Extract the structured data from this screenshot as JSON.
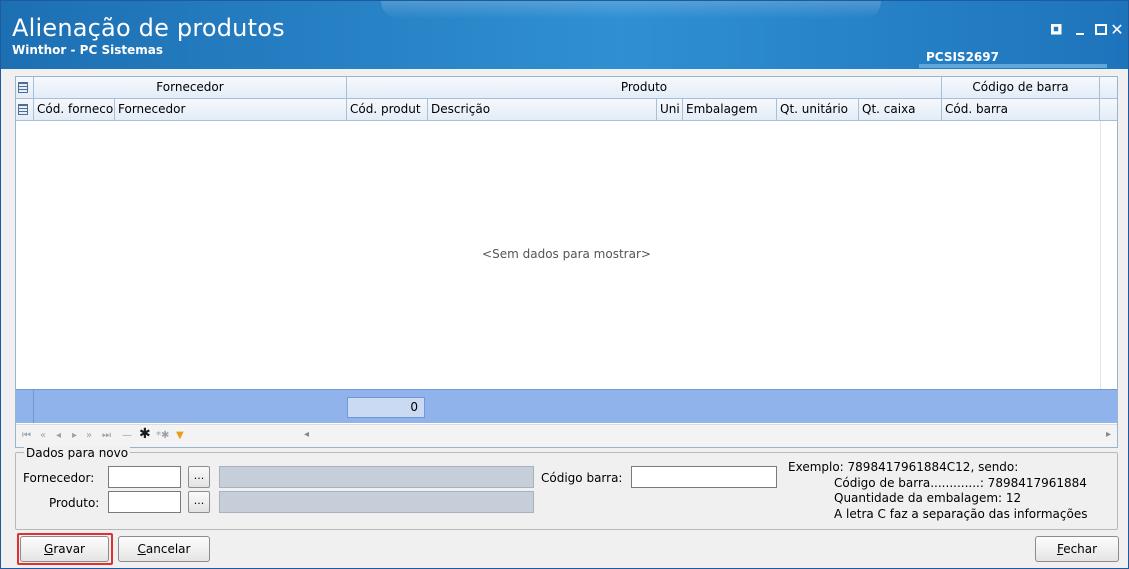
{
  "window": {
    "title": "Alienação de produtos",
    "subtitle": "Winthor - PC Sistemas",
    "routine_code": "PCSIS2697",
    "colors": {
      "titlebar": "#1d6fb3",
      "grid_footer": "#8fb3ea",
      "highlight": "#e03030"
    }
  },
  "grid": {
    "bands": [
      {
        "label": "Fornecedor"
      },
      {
        "label": "Produto"
      },
      {
        "label": "Código de barra"
      }
    ],
    "columns": [
      {
        "label": "Cód. forneco"
      },
      {
        "label": "Fornecedor"
      },
      {
        "label": "Cód. produt"
      },
      {
        "label": "Descrição"
      },
      {
        "label": "Uni"
      },
      {
        "label": "Embalagem"
      },
      {
        "label": "Qt. unitário"
      },
      {
        "label": "Qt. caixa"
      },
      {
        "label": "Cód. barra"
      }
    ],
    "empty_message": "<Sem dados para mostrar>",
    "footer_total": "0",
    "navigator_icons": [
      "first-icon",
      "prev-page-icon",
      "prev-icon",
      "next-icon",
      "next-page-icon",
      "last-icon",
      "delete-icon",
      "insert-icon",
      "insert-star-icon",
      "filter-icon"
    ]
  },
  "form": {
    "group_title": "Dados para novo",
    "fornecedor_label": "Fornecedor:",
    "fornecedor_value": "",
    "produto_label": "Produto:",
    "produto_value": "",
    "lookup_button": "...",
    "codigo_barra_label": "Código barra:",
    "codigo_barra_value": "",
    "example_lines": [
      "Exemplo: 7898417961884C12, sendo:",
      "Código de barra.............: 7898417961884",
      "Quantidade da embalagem: 12",
      "A letra C faz a separação das informações"
    ]
  },
  "buttons": {
    "gravar": {
      "mnemonic": "G",
      "rest": "ravar"
    },
    "cancelar": {
      "mnemonic": "C",
      "rest": "ancelar"
    },
    "fechar": {
      "mnemonic": "F",
      "rest": "echar"
    }
  }
}
